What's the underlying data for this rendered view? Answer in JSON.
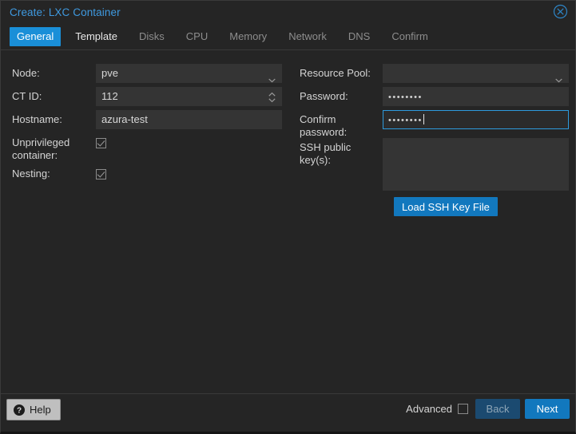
{
  "window": {
    "title": "Create: LXC Container",
    "close_icon": "close-circle-icon"
  },
  "tabs": [
    {
      "label": "General",
      "state": "active"
    },
    {
      "label": "Template",
      "state": "enabled"
    },
    {
      "label": "Disks",
      "state": "disabled"
    },
    {
      "label": "CPU",
      "state": "disabled"
    },
    {
      "label": "Memory",
      "state": "disabled"
    },
    {
      "label": "Network",
      "state": "disabled"
    },
    {
      "label": "DNS",
      "state": "disabled"
    },
    {
      "label": "Confirm",
      "state": "disabled"
    }
  ],
  "form": {
    "left": {
      "node": {
        "label": "Node:",
        "value": "pve",
        "icon": "chevron-down-icon"
      },
      "ct_id": {
        "label": "CT ID:",
        "value": "112",
        "icon": "spinner-updown-icon"
      },
      "hostname": {
        "label": "Hostname:",
        "value": "azura-test"
      },
      "unprivileged": {
        "label": "Unprivileged\ncontainer:",
        "checked": true
      },
      "nesting": {
        "label": "Nesting:",
        "checked": true
      }
    },
    "right": {
      "resource_pool": {
        "label": "Resource Pool:",
        "value": "",
        "icon": "chevron-down-icon"
      },
      "password": {
        "label": "Password:",
        "value": "••••••••"
      },
      "confirm_password": {
        "label": "Confirm\npassword:",
        "value": "••••••••",
        "focused": true
      },
      "ssh_keys": {
        "label": "SSH public\nkey(s):",
        "value": ""
      },
      "load_ssh_key_button": "Load SSH Key File"
    }
  },
  "footer": {
    "help_label": "Help",
    "help_icon": "question-mark-circle-icon",
    "advanced_label": "Advanced",
    "advanced_checked": false,
    "back_label": "Back",
    "next_label": "Next"
  },
  "colors": {
    "accent_blue": "#1278be",
    "title_blue": "#3f9ae0",
    "tab_active_blue": "#1a8fd8",
    "dialog_bg": "#252525",
    "field_bg": "#343434",
    "focus_border": "#2e9bdd",
    "back_disabled_bg": "#1b4a70"
  }
}
